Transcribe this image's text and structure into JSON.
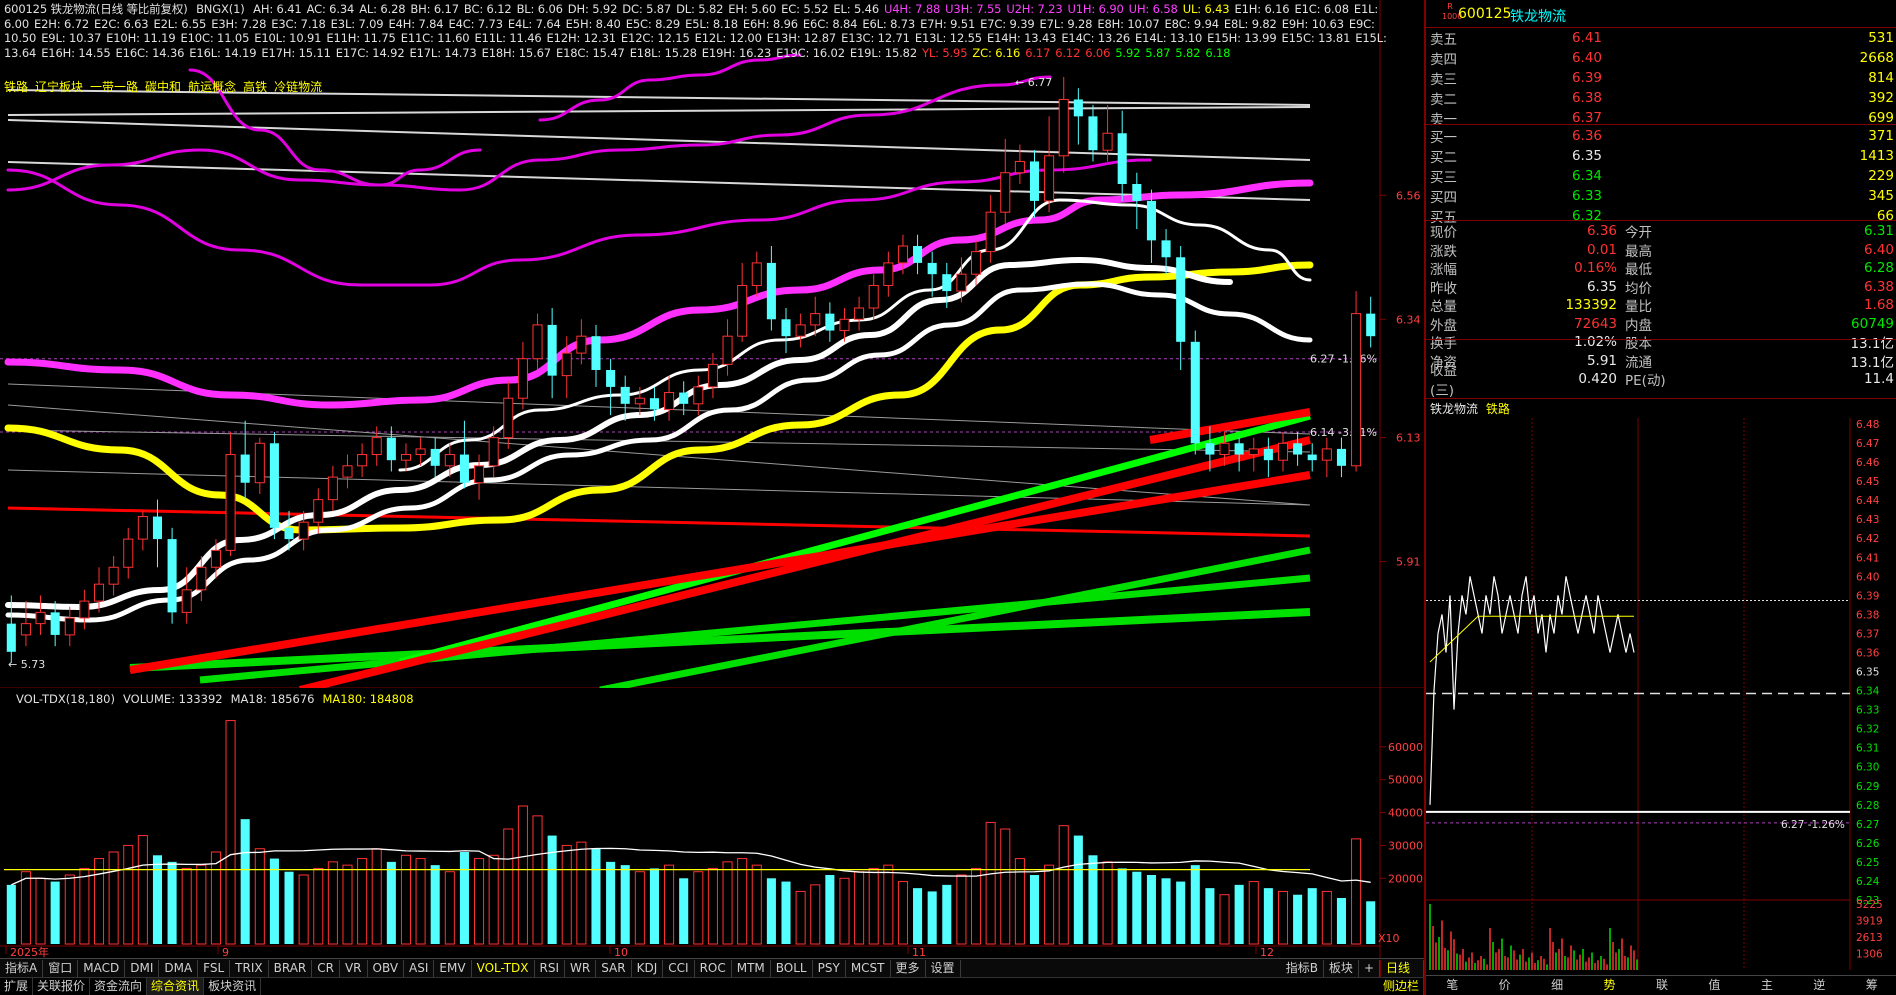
{
  "window": {
    "title_line": "600125 铁龙物流(日线 等比前复权)",
    "indicator_name": "BNGX(1)"
  },
  "indicator_values": [
    {
      "k": "AH",
      "v": "6.41",
      "c": "#e0e0e0"
    },
    {
      "k": "AC",
      "v": "6.34",
      "c": "#e0e0e0"
    },
    {
      "k": "AL",
      "v": "6.28",
      "c": "#e0e0e0"
    },
    {
      "k": "BH",
      "v": "6.17",
      "c": "#e0e0e0"
    },
    {
      "k": "BC",
      "v": "6.12",
      "c": "#e0e0e0"
    },
    {
      "k": "BL",
      "v": "6.06",
      "c": "#e0e0e0"
    },
    {
      "k": "DH",
      "v": "5.92",
      "c": "#e0e0e0"
    },
    {
      "k": "DC",
      "v": "5.87",
      "c": "#e0e0e0"
    },
    {
      "k": "DL",
      "v": "5.82",
      "c": "#e0e0e0"
    },
    {
      "k": "EH",
      "v": "5.60",
      "c": "#e0e0e0"
    },
    {
      "k": "EC",
      "v": "5.52",
      "c": "#e0e0e0"
    },
    {
      "k": "EL",
      "v": "5.46",
      "c": "#e0e0e0"
    },
    {
      "k": "U4H",
      "v": "7.88",
      "c": "#ff40ff"
    },
    {
      "k": "U3H",
      "v": "7.55",
      "c": "#ff40ff"
    },
    {
      "k": "U2H",
      "v": "7.23",
      "c": "#ff40ff"
    },
    {
      "k": "U1H",
      "v": "6.90",
      "c": "#ff40ff"
    },
    {
      "k": "UH",
      "v": "6.58",
      "c": "#ff40ff"
    },
    {
      "k": "UL",
      "v": "6.43",
      "c": "#ffff00"
    },
    {
      "k": "E1H",
      "v": "6.16",
      "c": "#e0e0e0"
    },
    {
      "k": "E1C",
      "v": "6.08",
      "c": "#e0e0e0"
    },
    {
      "k": "E1L",
      "v": "6.00",
      "c": "#e0e0e0"
    },
    {
      "k": "E2H",
      "v": "6.72",
      "c": "#e0e0e0"
    },
    {
      "k": "E2C",
      "v": "6.63",
      "c": "#e0e0e0"
    },
    {
      "k": "E2L",
      "v": "6.55",
      "c": "#e0e0e0"
    },
    {
      "k": "E3H",
      "v": "7.28",
      "c": "#e0e0e0"
    },
    {
      "k": "E3C",
      "v": "7.18",
      "c": "#e0e0e0"
    },
    {
      "k": "E3L",
      "v": "7.09",
      "c": "#e0e0e0"
    },
    {
      "k": "E4H",
      "v": "7.84",
      "c": "#e0e0e0"
    },
    {
      "k": "E4C",
      "v": "7.73",
      "c": "#e0e0e0"
    },
    {
      "k": "E4L",
      "v": "7.64",
      "c": "#e0e0e0"
    },
    {
      "k": "E5H",
      "v": "8.40",
      "c": "#e0e0e0"
    },
    {
      "k": "E5C",
      "v": "8.29",
      "c": "#e0e0e0"
    },
    {
      "k": "E5L",
      "v": "8.18",
      "c": "#e0e0e0"
    },
    {
      "k": "E6H",
      "v": "8.96",
      "c": "#e0e0e0"
    },
    {
      "k": "E6C",
      "v": "8.84",
      "c": "#e0e0e0"
    },
    {
      "k": "E6L",
      "v": "8.73",
      "c": "#e0e0e0"
    },
    {
      "k": "E7H",
      "v": "9.51",
      "c": "#e0e0e0"
    },
    {
      "k": "E7C",
      "v": "9.39",
      "c": "#e0e0e0"
    },
    {
      "k": "E7L",
      "v": "9.28",
      "c": "#e0e0e0"
    },
    {
      "k": "E8H",
      "v": "10.07",
      "c": "#e0e0e0"
    },
    {
      "k": "E8C",
      "v": "9.94",
      "c": "#e0e0e0"
    },
    {
      "k": "E8L",
      "v": "9.82",
      "c": "#e0e0e0"
    },
    {
      "k": "E9H",
      "v": "10.63",
      "c": "#e0e0e0"
    },
    {
      "k": "E9C",
      "v": "10.50",
      "c": "#e0e0e0"
    },
    {
      "k": "E9L",
      "v": "10.37",
      "c": "#e0e0e0"
    },
    {
      "k": "E10H",
      "v": "11.19",
      "c": "#e0e0e0"
    },
    {
      "k": "E10C",
      "v": "11.05",
      "c": "#e0e0e0"
    },
    {
      "k": "E10L",
      "v": "10.91",
      "c": "#e0e0e0"
    },
    {
      "k": "E11H",
      "v": "11.75",
      "c": "#e0e0e0"
    },
    {
      "k": "E11C",
      "v": "11.60",
      "c": "#e0e0e0"
    },
    {
      "k": "E11L",
      "v": "11.46",
      "c": "#e0e0e0"
    },
    {
      "k": "E12H",
      "v": "12.31",
      "c": "#e0e0e0"
    },
    {
      "k": "E12C",
      "v": "12.15",
      "c": "#e0e0e0"
    },
    {
      "k": "E12L",
      "v": "12.00",
      "c": "#e0e0e0"
    },
    {
      "k": "E13H",
      "v": "12.87",
      "c": "#e0e0e0"
    },
    {
      "k": "E13C",
      "v": "12.71",
      "c": "#e0e0e0"
    },
    {
      "k": "E13L",
      "v": "12.55",
      "c": "#e0e0e0"
    },
    {
      "k": "E14H",
      "v": "13.43",
      "c": "#e0e0e0"
    },
    {
      "k": "E14C",
      "v": "13.26",
      "c": "#e0e0e0"
    },
    {
      "k": "E14L",
      "v": "13.10",
      "c": "#e0e0e0"
    },
    {
      "k": "E15H",
      "v": "13.99",
      "c": "#e0e0e0"
    },
    {
      "k": "E15C",
      "v": "13.81",
      "c": "#e0e0e0"
    },
    {
      "k": "E15L",
      "v": "13.64",
      "c": "#e0e0e0"
    },
    {
      "k": "E16H",
      "v": "14.55",
      "c": "#e0e0e0"
    },
    {
      "k": "E16C",
      "v": "14.36",
      "c": "#e0e0e0"
    },
    {
      "k": "E16L",
      "v": "14.19",
      "c": "#e0e0e0"
    },
    {
      "k": "E17H",
      "v": "15.11",
      "c": "#e0e0e0"
    },
    {
      "k": "E17C",
      "v": "14.92",
      "c": "#e0e0e0"
    },
    {
      "k": "E17L",
      "v": "14.73",
      "c": "#e0e0e0"
    },
    {
      "k": "E18H",
      "v": "15.67",
      "c": "#e0e0e0"
    },
    {
      "k": "E18C",
      "v": "15.47",
      "c": "#e0e0e0"
    },
    {
      "k": "E18L",
      "v": "15.28",
      "c": "#e0e0e0"
    },
    {
      "k": "E19H",
      "v": "16.23",
      "c": "#e0e0e0"
    },
    {
      "k": "E19C",
      "v": "16.02",
      "c": "#e0e0e0"
    },
    {
      "k": "E19L",
      "v": "15.82",
      "c": "#e0e0e0"
    },
    {
      "k": "YL",
      "v": "5.95",
      "c": "#ff3232"
    },
    {
      "k": "ZC",
      "v": "6.16",
      "c": "#ffff00"
    },
    {
      "k": "",
      "v": "6.17",
      "c": "#ff3232"
    },
    {
      "k": "",
      "v": "6.12",
      "c": "#ff3232"
    },
    {
      "k": "",
      "v": "6.06",
      "c": "#ff3232"
    },
    {
      "k": "",
      "v": "5.92",
      "c": "#00ff00"
    },
    {
      "k": "",
      "v": "5.87",
      "c": "#00ff00"
    },
    {
      "k": "",
      "v": "5.82",
      "c": "#00ff00"
    },
    {
      "k": "",
      "v": "6.18",
      "c": "#00ff00"
    }
  ],
  "sectors": [
    "铁路",
    "辽宁板块",
    "一带一路",
    "碳中和",
    "航运概念",
    "高铁",
    "冷链物流"
  ],
  "price_axis": {
    "labels": [
      "6.56",
      "6.34",
      "6.13",
      "5.91"
    ],
    "peak_label": "6.77",
    "low_label": "5.73",
    "ann1": "6.27 -1.26%",
    "ann2": "6.14 -3.31%"
  },
  "volume_panel": {
    "title": "VOL-TDX(18,180)",
    "volume": "VOLUME: 133392",
    "ma18": "MA18: 185676",
    "ma180": "MA180: 184808",
    "axis": [
      "60000",
      "50000",
      "40000",
      "30000",
      "20000"
    ],
    "unit": "X10"
  },
  "date_axis": [
    "2025年",
    "9",
    "10",
    "11",
    "12"
  ],
  "chart_data": {
    "type": "candlestick",
    "title": "600125 铁龙物流(日线 等比前复权)",
    "ylim": [
      5.7,
      6.8
    ],
    "candles": [
      [
        5.8,
        5.75,
        5.85,
        5.73
      ],
      [
        5.78,
        5.8,
        5.84,
        5.76
      ],
      [
        5.8,
        5.82,
        5.85,
        5.78
      ],
      [
        5.82,
        5.78,
        5.84,
        5.76
      ],
      [
        5.78,
        5.81,
        5.83,
        5.76
      ],
      [
        5.81,
        5.84,
        5.86,
        5.79
      ],
      [
        5.84,
        5.87,
        5.9,
        5.82
      ],
      [
        5.87,
        5.9,
        5.92,
        5.85
      ],
      [
        5.9,
        5.95,
        5.97,
        5.88
      ],
      [
        5.95,
        5.99,
        6.0,
        5.93
      ],
      [
        5.99,
        5.95,
        6.02,
        5.9
      ],
      [
        5.95,
        5.82,
        5.97,
        5.8
      ],
      [
        5.82,
        5.86,
        5.9,
        5.8
      ],
      [
        5.86,
        5.9,
        5.92,
        5.84
      ],
      [
        5.9,
        5.93,
        5.95,
        5.88
      ],
      [
        5.93,
        6.1,
        6.14,
        5.92
      ],
      [
        6.1,
        6.05,
        6.16,
        6.02
      ],
      [
        6.05,
        6.12,
        6.13,
        6.03
      ],
      [
        6.12,
        5.97,
        6.14,
        5.95
      ],
      [
        5.97,
        5.95,
        6.0,
        5.93
      ],
      [
        5.95,
        5.98,
        6.0,
        5.93
      ],
      [
        5.98,
        6.02,
        6.04,
        5.96
      ],
      [
        6.02,
        6.06,
        6.08,
        6.0
      ],
      [
        6.06,
        6.08,
        6.1,
        6.04
      ],
      [
        6.08,
        6.1,
        6.12,
        6.06
      ],
      [
        6.1,
        6.13,
        6.15,
        6.08
      ],
      [
        6.13,
        6.09,
        6.15,
        6.07
      ],
      [
        6.09,
        6.1,
        6.12,
        6.07
      ],
      [
        6.1,
        6.11,
        6.13,
        6.08
      ],
      [
        6.11,
        6.08,
        6.13,
        6.06
      ],
      [
        6.08,
        6.1,
        6.12,
        6.06
      ],
      [
        6.1,
        6.05,
        6.16,
        6.04
      ],
      [
        6.05,
        6.08,
        6.1,
        6.02
      ],
      [
        6.08,
        6.13,
        6.15,
        6.06
      ],
      [
        6.13,
        6.2,
        6.23,
        6.11
      ],
      [
        6.2,
        6.27,
        6.3,
        6.18
      ],
      [
        6.27,
        6.33,
        6.35,
        6.25
      ],
      [
        6.33,
        6.24,
        6.36,
        6.2
      ],
      [
        6.24,
        6.28,
        6.31,
        6.2
      ],
      [
        6.28,
        6.31,
        6.34,
        6.26
      ],
      [
        6.31,
        6.25,
        6.33,
        6.22
      ],
      [
        6.25,
        6.22,
        6.27,
        6.17
      ],
      [
        6.22,
        6.19,
        6.24,
        6.16
      ],
      [
        6.19,
        6.2,
        6.22,
        6.17
      ],
      [
        6.2,
        6.18,
        6.22,
        6.16
      ],
      [
        6.18,
        6.21,
        6.24,
        6.16
      ],
      [
        6.21,
        6.19,
        6.23,
        6.17
      ],
      [
        6.19,
        6.22,
        6.24,
        6.17
      ],
      [
        6.22,
        6.26,
        6.28,
        6.2
      ],
      [
        6.26,
        6.31,
        6.34,
        6.24
      ],
      [
        6.31,
        6.4,
        6.44,
        6.3
      ],
      [
        6.4,
        6.44,
        6.46,
        6.38
      ],
      [
        6.44,
        6.34,
        6.47,
        6.32
      ],
      [
        6.34,
        6.31,
        6.36,
        6.28
      ],
      [
        6.31,
        6.33,
        6.35,
        6.29
      ],
      [
        6.33,
        6.35,
        6.38,
        6.31
      ],
      [
        6.35,
        6.32,
        6.37,
        6.3
      ],
      [
        6.32,
        6.34,
        6.36,
        6.3
      ],
      [
        6.34,
        6.36,
        6.38,
        6.32
      ],
      [
        6.36,
        6.4,
        6.42,
        6.34
      ],
      [
        6.4,
        6.44,
        6.46,
        6.38
      ],
      [
        6.44,
        6.47,
        6.49,
        6.42
      ],
      [
        6.47,
        6.44,
        6.49,
        6.42
      ],
      [
        6.44,
        6.42,
        6.46,
        6.38
      ],
      [
        6.42,
        6.39,
        6.44,
        6.36
      ],
      [
        6.39,
        6.42,
        6.45,
        6.37
      ],
      [
        6.42,
        6.46,
        6.48,
        6.4
      ],
      [
        6.46,
        6.53,
        6.56,
        6.44
      ],
      [
        6.53,
        6.6,
        6.66,
        6.51
      ],
      [
        6.6,
        6.62,
        6.65,
        6.58
      ],
      [
        6.62,
        6.55,
        6.64,
        6.52
      ],
      [
        6.55,
        6.63,
        6.7,
        6.53
      ],
      [
        6.63,
        6.73,
        6.77,
        6.6
      ],
      [
        6.73,
        6.7,
        6.75,
        6.65
      ],
      [
        6.7,
        6.64,
        6.72,
        6.62
      ],
      [
        6.64,
        6.67,
        6.72,
        6.62
      ],
      [
        6.67,
        6.58,
        6.71,
        6.55
      ],
      [
        6.58,
        6.55,
        6.6,
        6.5
      ],
      [
        6.55,
        6.48,
        6.57,
        6.44
      ],
      [
        6.48,
        6.45,
        6.5,
        6.42
      ],
      [
        6.45,
        6.3,
        6.47,
        6.25
      ],
      [
        6.3,
        6.12,
        6.32,
        6.1
      ],
      [
        6.12,
        6.1,
        6.15,
        6.07
      ],
      [
        6.1,
        6.12,
        6.14,
        6.08
      ],
      [
        6.12,
        6.1,
        6.13,
        6.07
      ],
      [
        6.1,
        6.11,
        6.13,
        6.07
      ],
      [
        6.11,
        6.09,
        6.13,
        6.06
      ],
      [
        6.09,
        6.12,
        6.14,
        6.07
      ],
      [
        6.12,
        6.1,
        6.14,
        6.08
      ],
      [
        6.1,
        6.09,
        6.12,
        6.07
      ],
      [
        6.09,
        6.11,
        6.13,
        6.06
      ],
      [
        6.11,
        6.08,
        6.13,
        6.06
      ],
      [
        6.08,
        6.35,
        6.39,
        6.07
      ],
      [
        6.35,
        6.31,
        6.38,
        6.29
      ]
    ],
    "volumes": [
      18000,
      22000,
      20000,
      19000,
      21000,
      23000,
      26000,
      28000,
      30000,
      33000,
      27000,
      25000,
      23000,
      24000,
      28000,
      68000,
      38000,
      29000,
      26000,
      22000,
      21000,
      23000,
      25000,
      24000,
      26000,
      29000,
      25000,
      27000,
      26000,
      24000,
      22000,
      28000,
      26000,
      27000,
      35000,
      42000,
      39000,
      33000,
      30000,
      31000,
      29000,
      25000,
      24000,
      22000,
      23000,
      24000,
      20000,
      22000,
      23000,
      25000,
      26000,
      24000,
      20000,
      19000,
      16000,
      18000,
      21000,
      20000,
      22000,
      23000,
      24000,
      19000,
      17000,
      16000,
      18000,
      21000,
      23000,
      37000,
      35000,
      26000,
      21000,
      24000,
      36000,
      33000,
      27000,
      25000,
      23000,
      22000,
      21000,
      20000,
      19000,
      24000,
      17000,
      15000,
      18000,
      19000,
      17000,
      16000,
      15000,
      17000,
      16000,
      14000,
      32000,
      13000
    ]
  },
  "order_book": {
    "asks": [
      {
        "label": "卖五",
        "price": "6.41",
        "vol": "531"
      },
      {
        "label": "卖四",
        "price": "6.40",
        "vol": "2668"
      },
      {
        "label": "卖三",
        "price": "6.39",
        "vol": "814"
      },
      {
        "label": "卖二",
        "price": "6.38",
        "vol": "392"
      },
      {
        "label": "卖一",
        "price": "6.37",
        "vol": "699"
      }
    ],
    "bids": [
      {
        "label": "买一",
        "price": "6.36",
        "vol": "371",
        "pc": "red"
      },
      {
        "label": "买二",
        "price": "6.35",
        "vol": "1413",
        "pc": "white"
      },
      {
        "label": "买三",
        "price": "6.34",
        "vol": "229",
        "pc": "green"
      },
      {
        "label": "买四",
        "price": "6.33",
        "vol": "345",
        "pc": "green"
      },
      {
        "label": "买五",
        "price": "6.32",
        "vol": "66",
        "pc": "green"
      }
    ]
  },
  "stock": {
    "code": "600125",
    "name": "铁龙物流",
    "badge": "R 1000"
  },
  "stats": [
    {
      "k": "现价",
      "v": "6.36",
      "vc": "red",
      "k2": "今开",
      "v2": "6.31",
      "v2c": "green"
    },
    {
      "k": "涨跌",
      "v": "0.01",
      "vc": "red",
      "k2": "最高",
      "v2": "6.40",
      "v2c": "red"
    },
    {
      "k": "涨幅",
      "v": "0.16%",
      "vc": "red",
      "k2": "最低",
      "v2": "6.28",
      "v2c": "green"
    },
    {
      "k": "昨收",
      "v": "6.35",
      "vc": "white",
      "k2": "均价",
      "v2": "6.38",
      "v2c": "red"
    },
    {
      "k": "总量",
      "v": "133392",
      "vc": "yellow",
      "k2": "量比",
      "v2": "1.68",
      "v2c": "red"
    },
    {
      "k": "外盘",
      "v": "72643",
      "vc": "red",
      "k2": "内盘",
      "v2": "60749",
      "v2c": "green"
    },
    {
      "k": "换手",
      "v": "1.02%",
      "vc": "white",
      "k2": "股本",
      "v2": "13.1亿",
      "v2c": "white"
    },
    {
      "k": "净资",
      "v": "5.91",
      "vc": "white",
      "k2": "流通",
      "v2": "13.1亿",
      "v2c": "white"
    },
    {
      "k": "收益(三)",
      "v": "0.420",
      "vc": "white",
      "k2": "PE(动)",
      "v2": "11.4",
      "v2c": "white"
    }
  ],
  "intraday": {
    "head_name": "铁龙物流",
    "head_sector": "铁路",
    "price_labels": [
      "6.48",
      "6.47",
      "6.46",
      "6.45",
      "6.44",
      "6.43",
      "6.42",
      "6.41",
      "6.40",
      "6.39",
      "6.38",
      "6.37",
      "6.36",
      "6.35",
      "6.34",
      "6.33",
      "6.32",
      "6.31",
      "6.30",
      "6.29",
      "6.28",
      "6.27",
      "6.26",
      "6.25",
      "6.24",
      "6.23"
    ],
    "vol_labels": [
      "5225",
      "3919",
      "2613",
      "1306"
    ],
    "ann": "6.27 -1.26%"
  },
  "bottom_tabs_row1": [
    "指标A",
    "窗口",
    "MACD",
    "DMI",
    "DMA",
    "FSL",
    "TRIX",
    "BRAR",
    "CR",
    "VR",
    "OBV",
    "ASI",
    "EMV",
    "VOL-TDX",
    "RSI",
    "WR",
    "SAR",
    "KDJ",
    "CCI",
    "ROC",
    "MTM",
    "BOLL",
    "PSY",
    "MCST",
    "更多",
    "设置"
  ],
  "bottom_tabs_row1_right": [
    "指标B",
    "板块",
    "+"
  ],
  "bottom_tabs_row2": [
    "扩展",
    "关联报价",
    "资金流向",
    "综合资讯",
    "板块资讯"
  ],
  "bottom_right_tab": "侧边栏",
  "period_tab": "日线",
  "right_tabs": [
    "笔",
    "价",
    "细",
    "势",
    "联",
    "值",
    "主",
    "逆",
    "筹"
  ]
}
